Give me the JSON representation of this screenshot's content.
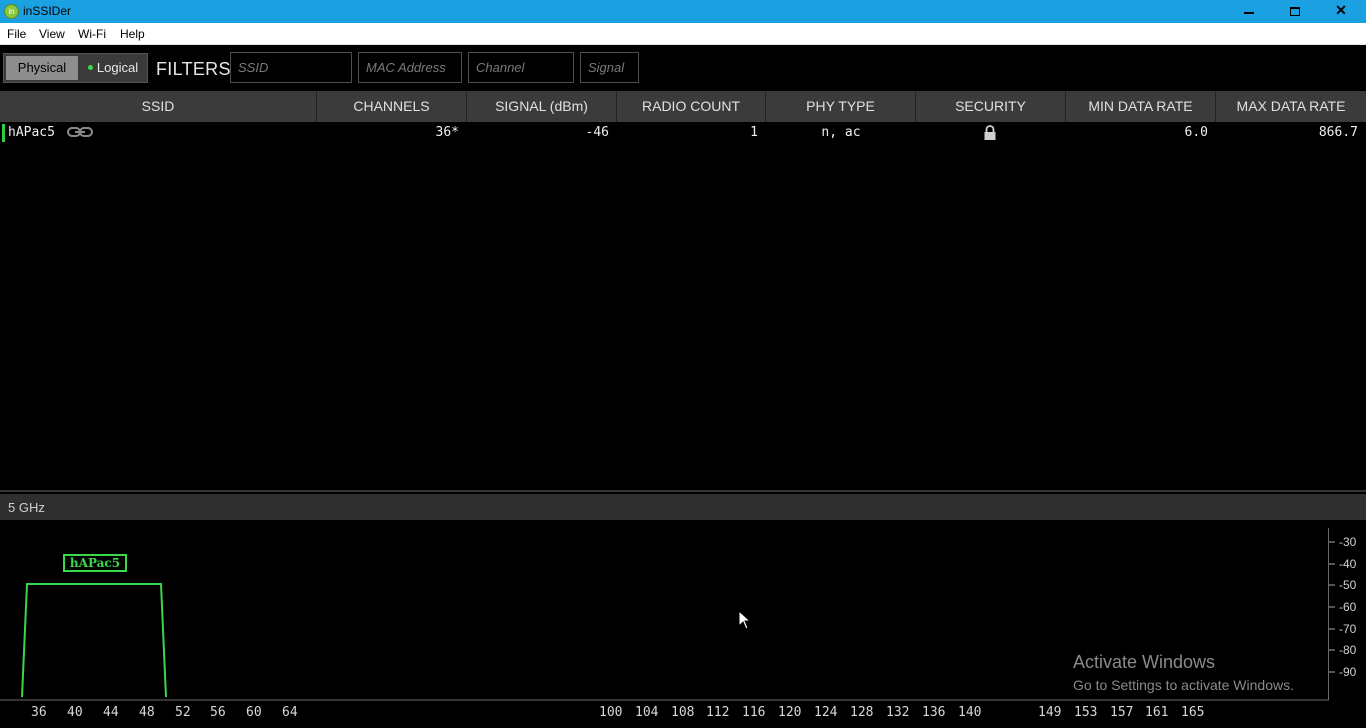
{
  "window": {
    "title": "inSSIDer",
    "icon": "inssider-app-icon",
    "controls": {
      "minimize": "minimize-icon",
      "maximize": "restore-icon",
      "close": "✕"
    }
  },
  "menu": [
    "File",
    "View",
    "Wi-Fi",
    "Help"
  ],
  "toolbar": {
    "view_toggle": {
      "physical": "Physical",
      "logical": "Logical",
      "selected": "Physical"
    },
    "filters_label": "FILTERS:",
    "filters": {
      "ssid_placeholder": "SSID",
      "mac_placeholder": "MAC Address",
      "channel_placeholder": "Channel",
      "signal_placeholder": "Signal"
    }
  },
  "table": {
    "columns": [
      "SSID",
      "CHANNELS",
      "SIGNAL (dBm)",
      "RADIO COUNT",
      "PHY TYPE",
      "SECURITY",
      "MIN DATA RATE",
      "MAX DATA RATE"
    ],
    "rows": [
      {
        "ssid": "hAPac5",
        "channels": "36*",
        "signal": "-46",
        "radio_count": "1",
        "phy_type": "n, ac",
        "security": "lock-icon",
        "min_rate": "6.0",
        "max_rate": "866.7",
        "status_color": "#2ecc40",
        "connected_icon": "link-icon"
      }
    ]
  },
  "band": {
    "label": "5 GHz",
    "y_axis": [
      "-30",
      "-40",
      "-50",
      "-60",
      "-70",
      "-80",
      "-90"
    ],
    "x_ticks": [
      "36",
      "40",
      "44",
      "48",
      "52",
      "56",
      "60",
      "64",
      "100",
      "104",
      "108",
      "112",
      "116",
      "120",
      "124",
      "128",
      "132",
      "136",
      "140",
      "149",
      "153",
      "157",
      "161",
      "165"
    ],
    "networks": [
      {
        "ssid": "hAPac5",
        "channel_from": 34,
        "channel_to": 50,
        "signal_dbm": -46,
        "color": "#39d84a"
      }
    ]
  },
  "watermark": {
    "title": "Activate Windows",
    "subtitle": "Go to Settings to activate Windows."
  }
}
